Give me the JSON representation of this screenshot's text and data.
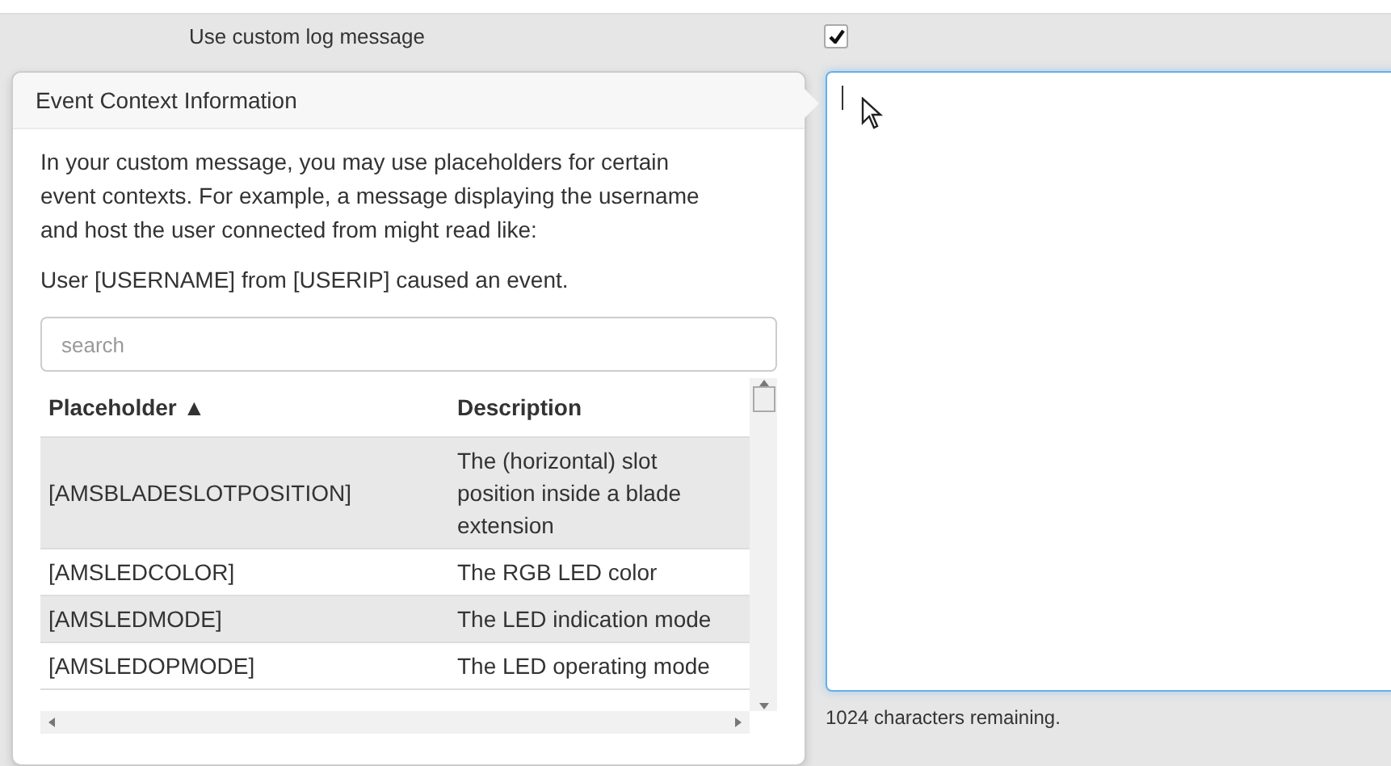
{
  "option": {
    "label": "Use custom log message",
    "checked": true
  },
  "popover": {
    "title": "Event Context Information",
    "intro": "In your custom message, you may use placeholders for certain event contexts. For example, a message displaying the username and host the user connected from might read like:",
    "example": "User [USERNAME] from [USERIP] caused an event.",
    "search": {
      "placeholder": "search"
    },
    "table": {
      "columns": [
        {
          "label": "Placeholder",
          "sort_indicator": "▲"
        },
        {
          "label": "Description"
        }
      ],
      "rows": [
        {
          "placeholder": "[AMSBLADESLOTPOSITION]",
          "description": "The (horizontal) slot position inside a blade extension"
        },
        {
          "placeholder": "[AMSLEDCOLOR]",
          "description": "The RGB LED color"
        },
        {
          "placeholder": "[AMSLEDMODE]",
          "description": "The LED indication mode"
        },
        {
          "placeholder": "[AMSLEDOPMODE]",
          "description": "The LED operating mode"
        }
      ]
    }
  },
  "message": {
    "remaining": "1024 characters remaining."
  }
}
